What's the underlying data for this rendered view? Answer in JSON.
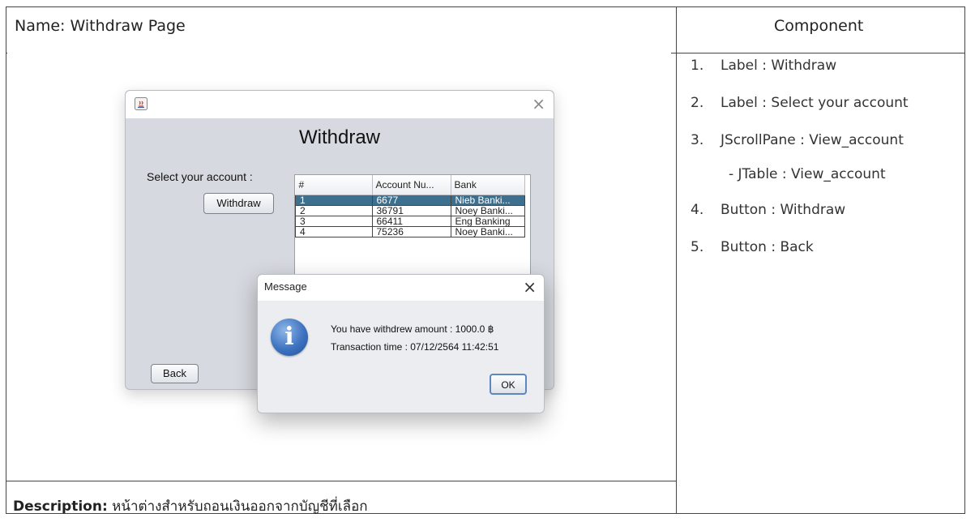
{
  "doc": {
    "name_label": "Name: Withdraw Page",
    "component_header": "Component",
    "components": [
      {
        "num": "1.",
        "text": "Label : Withdraw"
      },
      {
        "num": "2.",
        "text": "Label : Select your account"
      },
      {
        "num": "3.",
        "text": "JScrollPane : View_account"
      },
      {
        "num": "",
        "text": "- JTable : View_account"
      },
      {
        "num": "4.",
        "text": "Button : Withdraw"
      },
      {
        "num": "5.",
        "text": "Button : Back"
      }
    ],
    "description_label": "Description:",
    "description_text": "หน้าต่างสำหรับถอนเงินออกจากบัญชีที่เลือก"
  },
  "app": {
    "title": "Withdraw",
    "select_label": "Select your account :",
    "withdraw_button": "Withdraw",
    "back_button": "Back",
    "table": {
      "headers": [
        "#",
        "Account Nu...",
        "Bank"
      ],
      "rows": [
        [
          "1",
          "6677",
          "Nieb Banki..."
        ],
        [
          "2",
          "36791",
          "Noey Banki..."
        ],
        [
          "3",
          "66411",
          "Eng Banking"
        ],
        [
          "4",
          "75236",
          "Noey Banki..."
        ]
      ],
      "selected_row": 1
    }
  },
  "dialog": {
    "title": "Message",
    "line1": "You have withdrew amount : 1000.0 ฿",
    "line2": "Transaction time : 07/12/2564 11:42:51",
    "ok_button": "OK"
  },
  "icons": {
    "window": "java-icon",
    "close": "close-icon",
    "dialog": "info-icon"
  },
  "colors": {
    "selected_row": "#3d6f8e",
    "window_bg": "#d6d9df",
    "dialog_bg": "#ebedf0"
  }
}
